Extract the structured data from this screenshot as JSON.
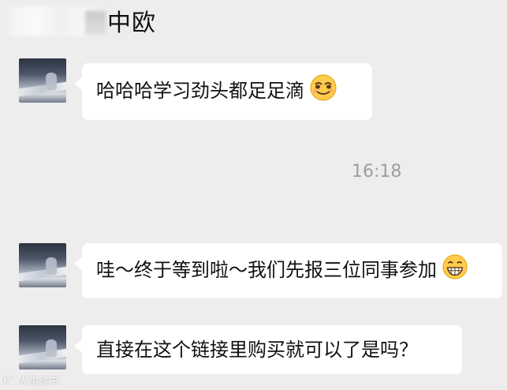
{
  "header": {
    "title": "中欧"
  },
  "messages": [
    {
      "text": "哈哈哈学习劲头都足足滴",
      "emoji": "grinning-squint-emoji"
    },
    {
      "text": "哇～终于等到啦～我们先报三位同事参加",
      "emoji": "big-grin-emoji"
    },
    {
      "text": "直接在这个链接里购买就可以了是吗？",
      "emoji": ""
    }
  ],
  "timestamp": "16:18",
  "watermark": "K° 大鱼读书",
  "colors": {
    "background": "#ededed",
    "bubble": "#ffffff",
    "timestamp": "#9e9e9e"
  }
}
